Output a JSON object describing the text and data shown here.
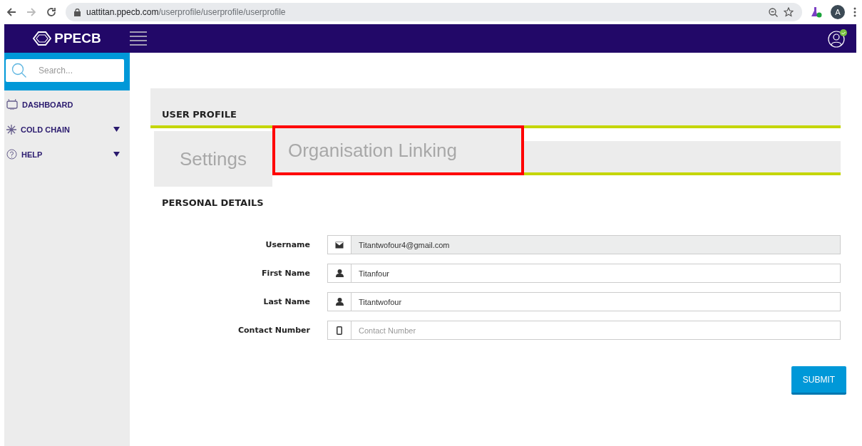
{
  "browser": {
    "url_host": "uattitan.ppecb.com",
    "url_path": "/userprofile/userprofile/userprofile",
    "avatar": "A"
  },
  "header": {
    "logo": "PPECB"
  },
  "sidebar": {
    "search": {
      "placeholder": "Search..."
    },
    "items": [
      {
        "label": "DASHBOARD",
        "kind": "dashboard",
        "expandable": false
      },
      {
        "label": "COLD CHAIN",
        "kind": "snow",
        "expandable": true
      },
      {
        "label": "HELP",
        "kind": "help",
        "expandable": true
      }
    ]
  },
  "page": {
    "title": "USER PROFILE",
    "tabs": [
      {
        "label": "Settings",
        "selected": true,
        "highlighted": false
      },
      {
        "label": "Organisation Linking",
        "selected": false,
        "highlighted": true
      }
    ],
    "section": "PERSONAL DETAILS",
    "fields": [
      {
        "label": "Username",
        "kind": "mail",
        "value": "Titantwofour4@gmail.com",
        "disabled": true
      },
      {
        "label": "First Name",
        "kind": "person",
        "value": "Titanfour",
        "disabled": false
      },
      {
        "label": "Last Name",
        "kind": "person",
        "value": "Titantwofour",
        "disabled": false
      },
      {
        "label": "Contact Number",
        "kind": "phone",
        "placeholder": "Contact Number",
        "disabled": false
      }
    ],
    "submit": "SUBMIT"
  }
}
